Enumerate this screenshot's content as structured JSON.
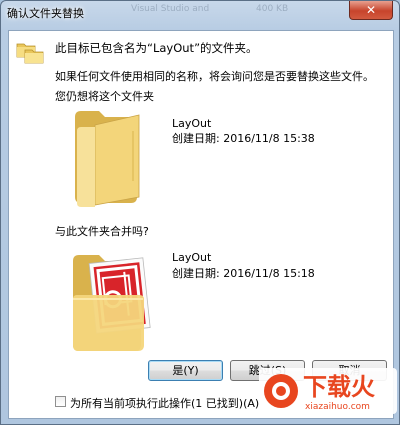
{
  "window": {
    "title": "确认文件夹替换"
  },
  "titlebar": {
    "ghost_text_1": "Visual Studio and",
    "ghost_text_2": "400 KB"
  },
  "dialog": {
    "heading": "此目标已包含名为“LayOut”的文件夹。",
    "info": "如果任何文件使用相同的名称，将会询问您是否要替换这些文件。",
    "question_replace": "您仍想将这个文件夹",
    "question_merge": "与此文件夹合并吗?"
  },
  "source_folder": {
    "name": "LayOut",
    "created": "创建日期: 2016/11/8 15:38"
  },
  "target_folder": {
    "name": "LayOut",
    "created": "创建日期: 2016/11/8 15:18"
  },
  "buttons": {
    "yes": "是(Y)",
    "skip": "跳过(S)",
    "cancel": "取消"
  },
  "checkbox": {
    "label": "为所有当前项执行此操作(1 已找到)(A)",
    "checked": false
  },
  "watermark": {
    "brand": "下载火",
    "url": "xiazaihuo.com"
  },
  "colors": {
    "accent": "#e8461f",
    "folder": "#f0d070"
  }
}
